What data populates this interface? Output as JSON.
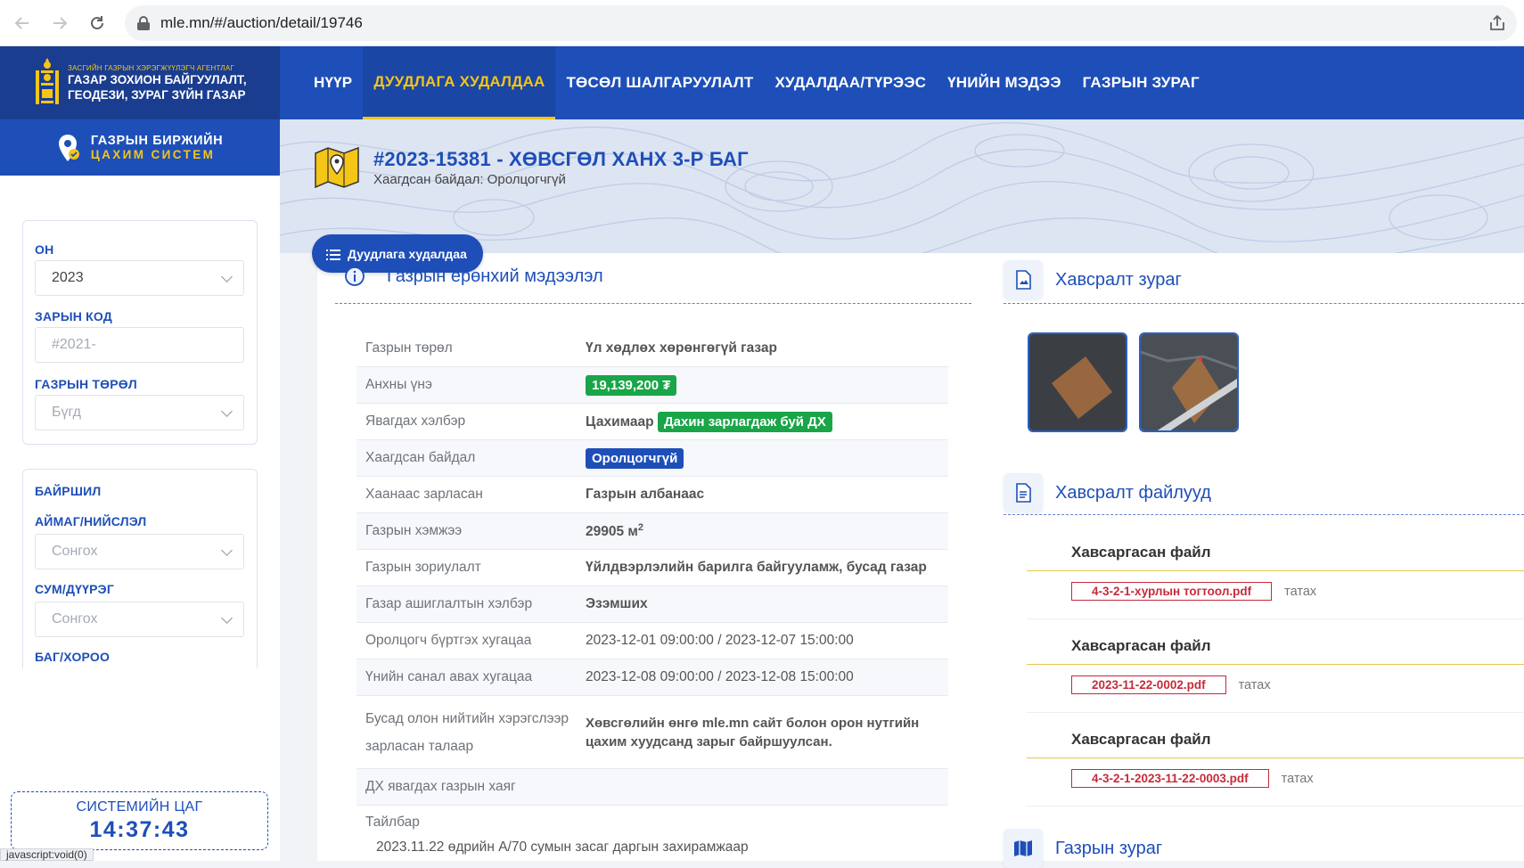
{
  "browser": {
    "url": "mle.mn/#/auction/detail/19746",
    "status_text": "javascript:void(0)"
  },
  "header": {
    "logo_small": "ЗАСГИЙН ГАЗРЫН ХЭРЭГЖҮҮЛЭГЧ АГЕНТЛАГ",
    "logo_line1": "ГАЗАР ЗОХИОН БАЙГУУЛАЛТ,",
    "logo_line2": "ГЕОДЕЗИ, ЗУРАГ ЗҮЙН ГАЗАР",
    "nav": [
      {
        "label": "НҮҮР"
      },
      {
        "label": "ДУУДЛАГА ХУДАЛДАА"
      },
      {
        "label": "ТӨСӨЛ ШАЛГАРУУЛАЛТ"
      },
      {
        "label": "ХУДАЛДАА/ТҮРЭЭС"
      },
      {
        "label": "ҮНИЙН МЭДЭЭ"
      },
      {
        "label": "ГАЗРЫН ЗУРАГ"
      }
    ]
  },
  "sidebar": {
    "system_line1": "ГАЗРЫН БИРЖИЙН",
    "system_line2": "ЦАХИМ СИСТЕМ",
    "filters": {
      "year_label": "ОН",
      "year_value": "2023",
      "code_label": "ЗАРЫН КОД",
      "code_placeholder": "#2021-",
      "type_label": "ГАЗРЫН ТӨРӨЛ",
      "type_value": "Бүгд",
      "location_label": "БАЙРШИЛ",
      "aimag_label": "АЙМАГ/НИЙСЛЭЛ",
      "aimag_value": "Сонгох",
      "sum_label": "СУМ/ДҮҮРЭГ",
      "sum_value": "Сонгох",
      "bag_label": "БАГ/ХОРОО"
    },
    "clock_label": "СИСТЕМИЙН ЦАГ",
    "clock_time": "14:37:43"
  },
  "banner": {
    "title": "#2023-15381 - ХӨВСГӨЛ ХАНХ 3-Р БАГ",
    "subtitle": "Хаагдсан байдал: Оролцогчгүй"
  },
  "main": {
    "pill_label": "Дуудлага худалдаа",
    "general_title": "Газрын ерөнхий мэдээлэл",
    "rows": [
      {
        "k": "Газрын төрөл",
        "v": "Үл хөдлөх хөрөнгөгүй газар"
      },
      {
        "k": "Анхны үнэ",
        "v": "19,139,200 ₮"
      },
      {
        "k": "Явагдах хэлбэр",
        "v": "Цахимаар",
        "badge": "Дахин зарлагдаж буй ДХ"
      },
      {
        "k": "Хаагдсан байдал",
        "v": "Оролцогчгүй"
      },
      {
        "k": "Хаанаас зарласан",
        "v": "Газрын албанаас"
      },
      {
        "k": "Газрын хэмжээ",
        "v": "29905 м",
        "sup": "2"
      },
      {
        "k": "Газрын зориулалт",
        "v": "Үйлдвэрлэлийн барилга байгууламж, бусад газар"
      },
      {
        "k": "Газар ашиглалтын хэлбэр",
        "v": "Эзэмших"
      },
      {
        "k": "Оролцогч бүртгэх хугацаа",
        "v": "2023-12-01 09:00:00 / 2023-12-07 15:00:00"
      },
      {
        "k": "Үнийн санал авах хугацаа",
        "v": "2023-12-08 09:00:00 / 2023-12-08 15:00:00"
      },
      {
        "k1": "Бусад олон нийтийн хэрэгслээр",
        "k2": "зарласан талаар",
        "v1": "Хөвсгөлийн өнгө mle.mn сайт болон орон нутгийн",
        "v2": "цахим хуудсанд зарыг байршуулсан."
      },
      {
        "k": "ДХ явагдах газрын хаяг",
        "v": ""
      }
    ],
    "note_label": "Тайлбар",
    "note_text": "2023.11.22 өдрийн А/70 сумын засаг даргын захирамжаар",
    "attach_map_title": "Хавсралт зураг",
    "attach_files_title": "Хавсралт файлууд",
    "files": [
      {
        "title": "Хавсаргасан файл",
        "file": "4-3-2-1-хурлын тогтоол.pdf",
        "action": "татах"
      },
      {
        "title": "Хавсаргасан файл",
        "file": "2023-11-22-0002.pdf",
        "action": "татах"
      },
      {
        "title": "Хавсаргасан файл",
        "file": "4-3-2-1-2023-11-22-0003.pdf",
        "action": "татах"
      }
    ],
    "land_map_title": "Газрын зураг"
  }
}
